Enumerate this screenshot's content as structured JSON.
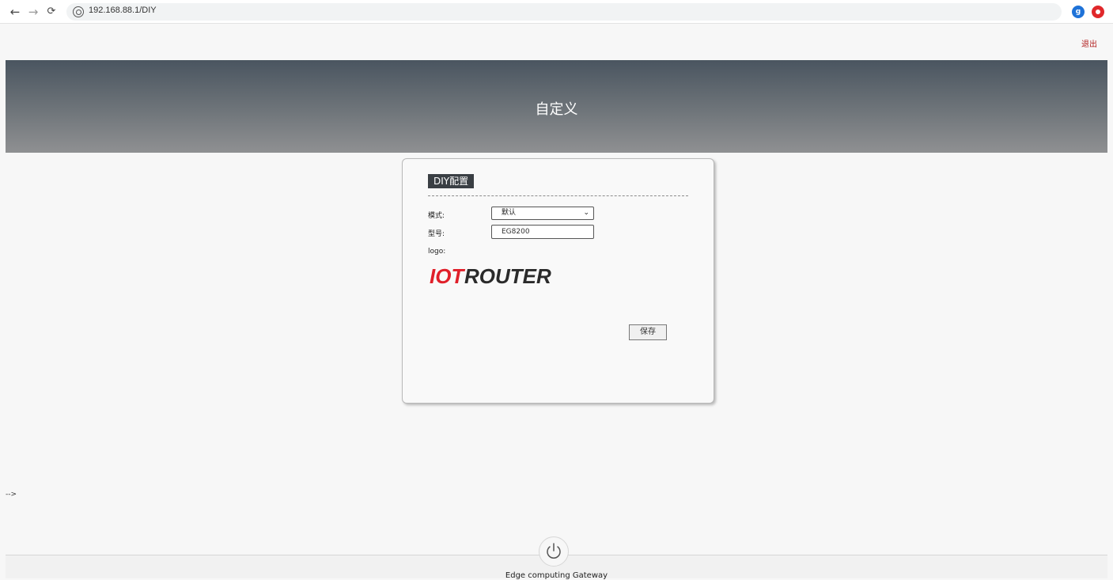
{
  "browser": {
    "url": "192.168.88.1/DIY",
    "back_icon": "arrow-left-icon",
    "forward_icon": "arrow-right-icon",
    "reload_icon": "reload-icon",
    "extension_1_letter": "g"
  },
  "header": {
    "logout_label": "退出",
    "banner_title": "自定义"
  },
  "panel": {
    "title": "DIY配置",
    "mode_label": "模式:",
    "mode_value": "默认",
    "model_label": "型号:",
    "model_value": "EG8200",
    "logo_label": "logo:",
    "logo_text_red": "IOT",
    "logo_text_dark": "ROUTER",
    "save_label": "保存"
  },
  "misc": {
    "stray_text": "-->"
  },
  "footer": {
    "text": "Edge computing Gateway"
  },
  "colors": {
    "logo_red": "#e0202a",
    "logo_dark": "#2b2b2b",
    "logout": "#b21f1f"
  }
}
